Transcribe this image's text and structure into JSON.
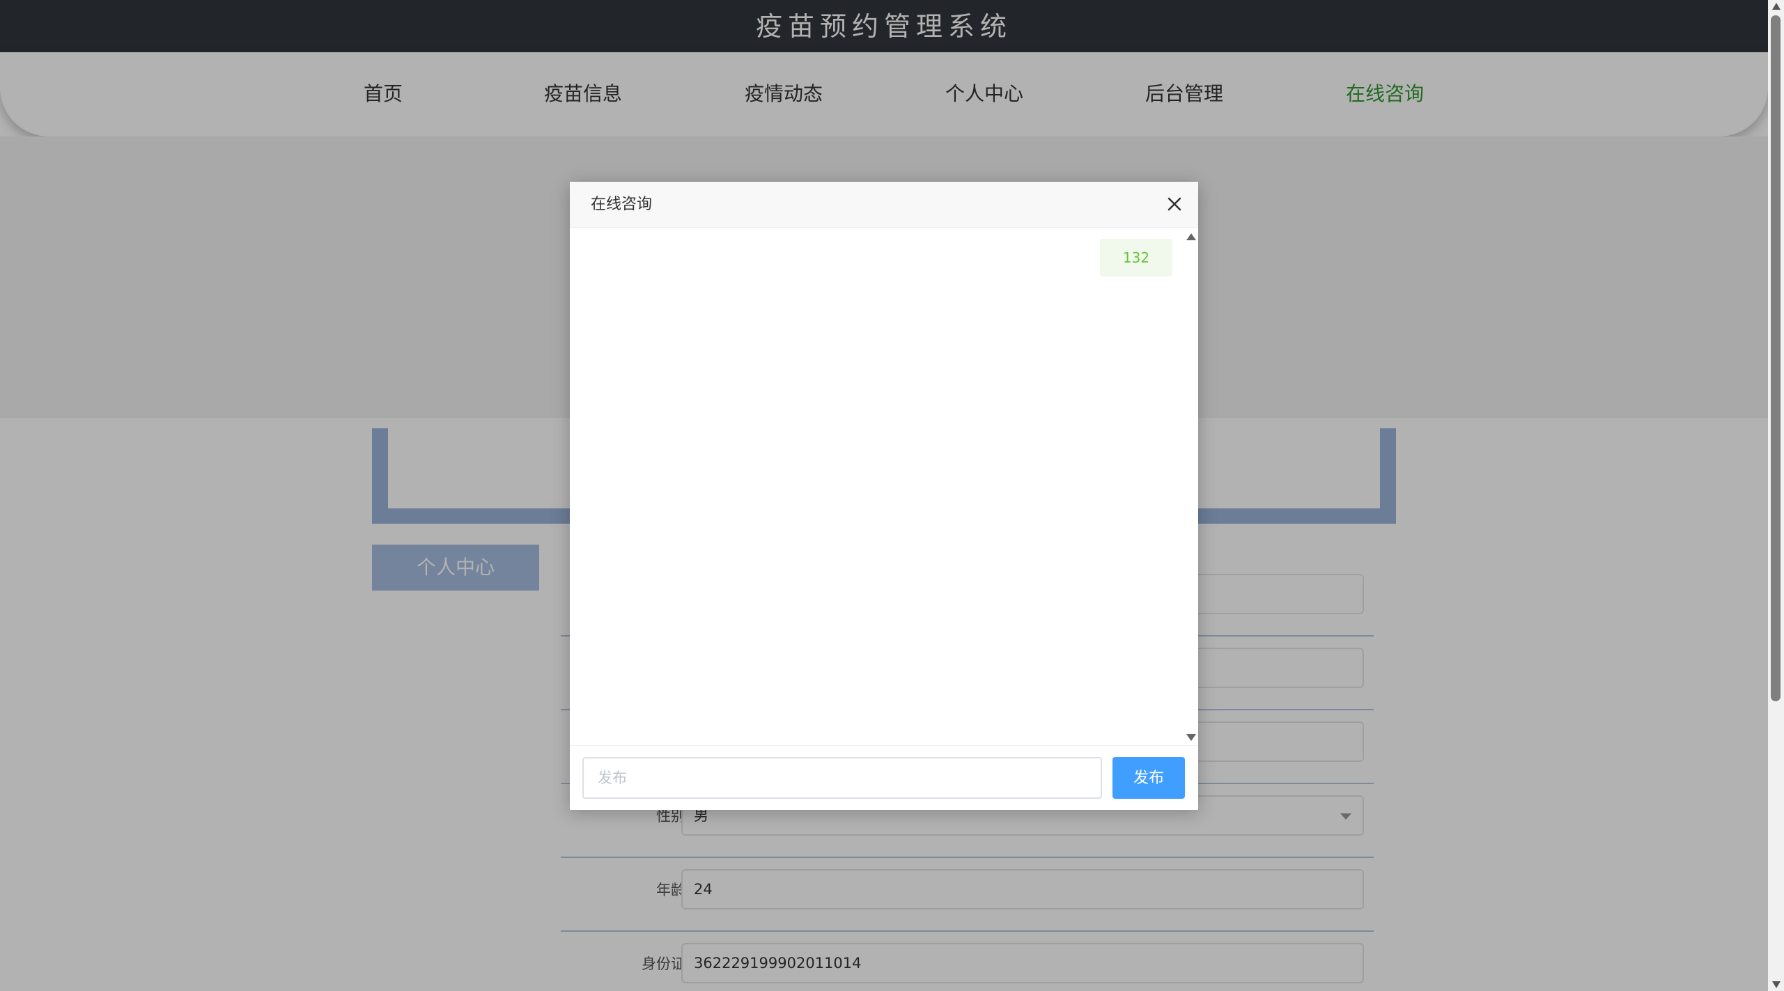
{
  "header": {
    "title": "疫苗预约管理系统"
  },
  "nav": {
    "items": [
      {
        "label": "首页"
      },
      {
        "label": "疫苗信息"
      },
      {
        "label": "疫情动态"
      },
      {
        "label": "个人中心"
      },
      {
        "label": "后台管理"
      },
      {
        "label": "在线咨询"
      }
    ],
    "active": "在线咨询",
    "active_color": "#2e9a2e"
  },
  "sidebar": {
    "tab_label": "个人中心"
  },
  "form": {
    "gender": {
      "label": "性别",
      "value": "男"
    },
    "age": {
      "label": "年龄",
      "value": "24"
    },
    "id_card": {
      "label": "身份证",
      "value": "362229199902011014"
    }
  },
  "dialog": {
    "title": "在线咨询",
    "messages": [
      {
        "text": "132",
        "side": "right"
      }
    ],
    "input_placeholder": "发布",
    "submit_label": "发布",
    "submit_color": "#409eff"
  }
}
